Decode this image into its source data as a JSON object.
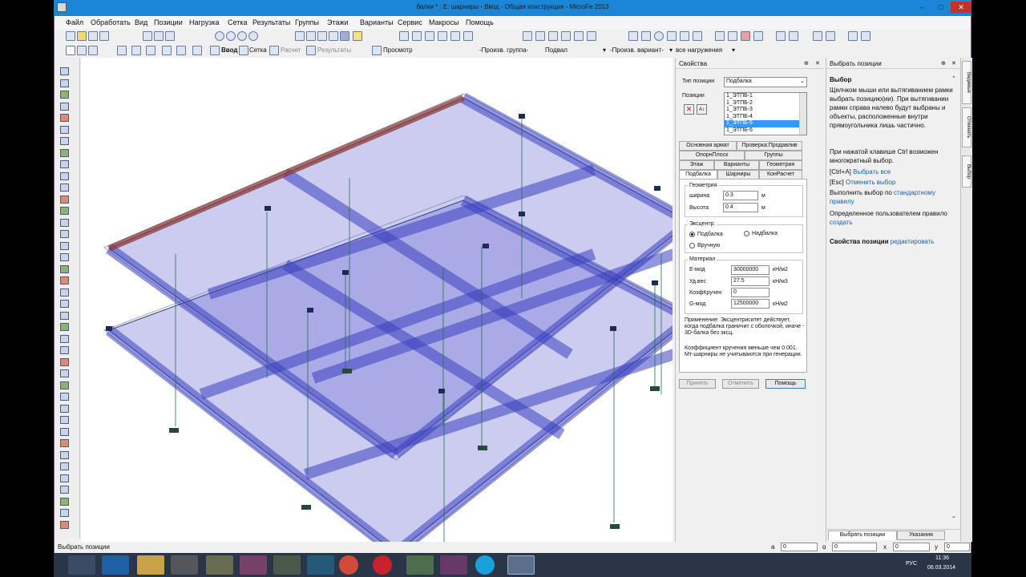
{
  "window": {
    "title": "балки * : Е: шарниры - Ввод - Общая конструкция - MicroFe 2013",
    "controls": {
      "minimize": "‒",
      "maximize": "□",
      "close": "✕"
    }
  },
  "menu": [
    "Файл",
    "Обработать",
    "Вид",
    "Позиции",
    "Нагрузка",
    "Сетка",
    "Результаты",
    "Группы",
    "Этажи",
    "Варианты",
    "Сервис",
    "Макросы",
    "Помощь"
  ],
  "toolbar2": {
    "mode_input": "Ввод",
    "grid": "Сетка",
    "calc": "Расчет",
    "results": "Результаты",
    "preview": "Просмотр",
    "group_select": "-Произв. группа-",
    "floor_select": "Подвал",
    "variant_select": "-Произв. вариант-",
    "load_select": "все нагружения"
  },
  "props": {
    "title": "Свойства",
    "type_label": "Тип позиции",
    "type_value": "Подбалка",
    "positions_label": "Позиции",
    "positions": [
      "1_ЭТПБ-1",
      "1_ЭТПБ-2",
      "1_ЭТПБ-3",
      "1_ЭТПБ-4",
      "1_ЭТПБ-5",
      "1_ЭТПБ-6"
    ],
    "selected_position": "1_ЭТПБ-5",
    "tabs_row1": [
      "Основная армат",
      "Проверка:Продавлив"
    ],
    "tabs_row2": [
      "ОпорнПлоск",
      "Группы"
    ],
    "tabs_row3": [
      "Этаж",
      "Варианты",
      "Геометрия"
    ],
    "tabs_row4": [
      "Подбалка",
      "Шарниры",
      "КонРасчет"
    ],
    "geometry_title": "Геометрия",
    "width_label": "ширина",
    "width_value": "0.3",
    "width_unit": "м",
    "height_label": "Высота",
    "height_value": "0.4",
    "height_unit": "м",
    "ecc_title": "Эксцентр.",
    "ecc_options": [
      "Подбалка",
      "Надбалка",
      "Вручную"
    ],
    "material_title": "Материал",
    "emod_label": "Е-мод",
    "emod_value": "30000000",
    "emod_unit": "кН/м2",
    "weight_label": "Уд.вес",
    "weight_value": "27.5",
    "weight_unit": "кН/м3",
    "tors_label": "КоэфКручен",
    "tors_value": "0",
    "gmod_label": "G-мод",
    "gmod_value": "12500000",
    "gmod_unit": "кН/м2",
    "note1": "Применение: Эксцентриситет действует, когда подбалка граничит с оболочкой, иначе - 3D-балка без эксц.",
    "note2": "Коэффициент кручения меньше чем 0.001. Мт-шарниры не учитываются при генерации.",
    "btn_accept": "Принять",
    "btn_cancel": "Отменить",
    "btn_help": "Помощь"
  },
  "right": {
    "title": "Выбрать позиции",
    "heading": "Выбор",
    "text1": "Щелчком мыши или вытягиванием рамки выбрать позицию(ии). При вытягивании рамки справа налево будут выбраны и объекты, расположенные внутри прямоугольника лишь частично.",
    "text2": "При нажатой клавише Ctrl возможен многократный выбор.",
    "ctrl_a": "[Ctrl+A]",
    "ctrl_a_link": "Выбрать все",
    "esc": "[Esc]",
    "esc_link": "Отменить выбор",
    "std_text": "Выполнить выбор по",
    "std_link": "стандартному правилу",
    "user_text": "Определенное пользователем правило",
    "user_link": "создать",
    "props_text": "Свойства позиции",
    "props_link": "редактировать",
    "bottom_tab1": "Выбрать позиции",
    "bottom_tab2": "Указания"
  },
  "vtabs": [
    "Видимые",
    "Отменить",
    "Выбор"
  ],
  "status": {
    "left": "Выбрать позиции",
    "fields": [
      "0",
      "0",
      "0",
      "0"
    ],
    "labels": [
      "a",
      "ɑ",
      "x",
      "y"
    ]
  },
  "taskbar": {
    "lang": "РУС",
    "time": "11:36",
    "date": "06.03.2014"
  }
}
